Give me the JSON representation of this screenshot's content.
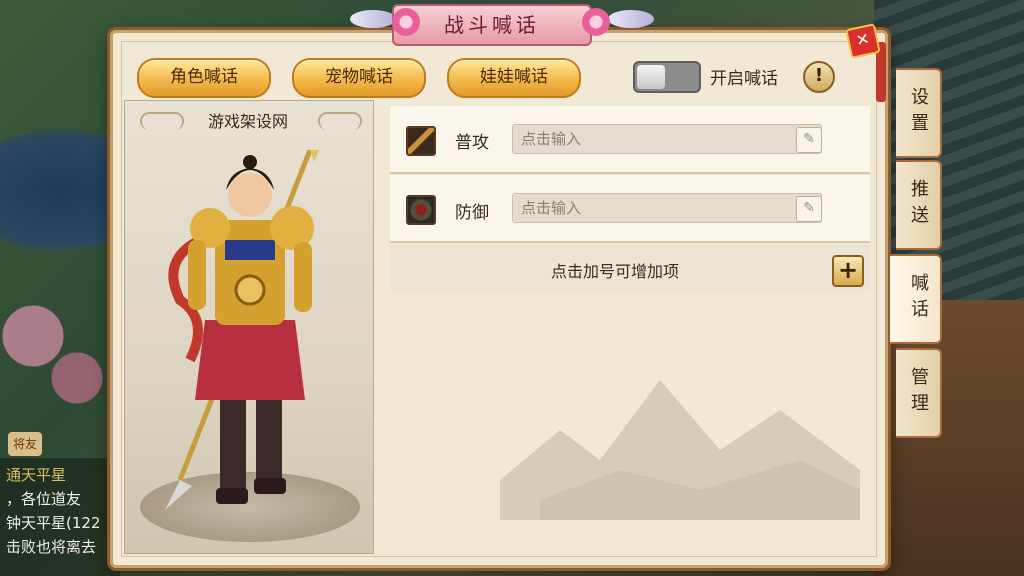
{
  "window": {
    "title": "战斗喊话"
  },
  "tabs": [
    {
      "label": "角色喊话"
    },
    {
      "label": "宠物喊话"
    },
    {
      "label": "娃娃喊话"
    }
  ],
  "toggle": {
    "label": "开启喊话",
    "state": "off"
  },
  "info_button": {
    "label": "!"
  },
  "close_button": {
    "label": "✕"
  },
  "portrait": {
    "title": "游戏架设网"
  },
  "skills": [
    {
      "label": "普攻",
      "placeholder": "点击输入"
    },
    {
      "label": "防御",
      "placeholder": "点击输入"
    }
  ],
  "add_row": {
    "label": "点击加号可增加项",
    "button": "+"
  },
  "side_tabs": [
    {
      "label": "设置"
    },
    {
      "label": "推送"
    },
    {
      "label": "喊话"
    },
    {
      "label": "管理"
    }
  ],
  "active_side_tab": "喊话",
  "chat": {
    "badge": "将友",
    "lines": [
      "通天平星",
      "，各位道友",
      "钟天平星(122",
      "击败也将离去"
    ]
  },
  "colors": {
    "accent_gold": "#f3b94a",
    "title_pink": "#e79aa5",
    "close_red": "#d8302a"
  }
}
